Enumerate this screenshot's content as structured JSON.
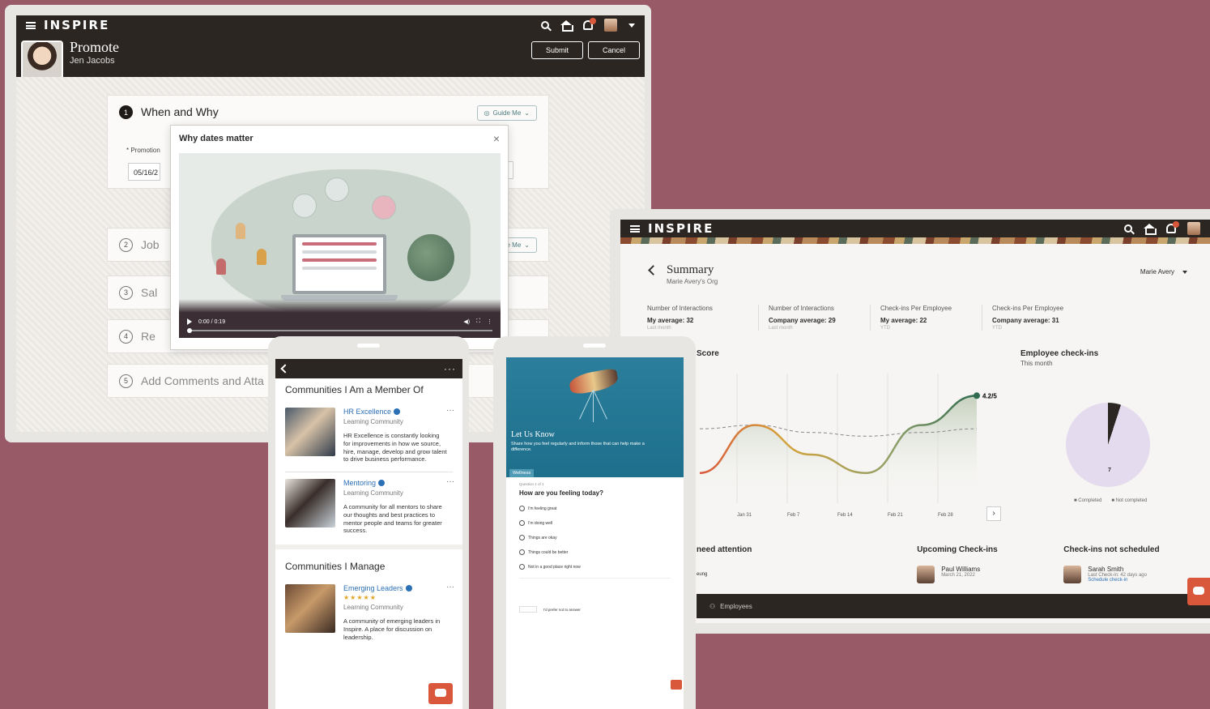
{
  "promote": {
    "brand": "INSPIRE",
    "title": "Promote",
    "subtitle": "Jen Jacobs",
    "submit_label": "Submit",
    "cancel_label": "Cancel",
    "guide_label": "Guide Me",
    "promotion_label": "* Promotion",
    "date_value": "05/16/2",
    "steps": [
      {
        "num": "1",
        "label": "When and Why"
      },
      {
        "num": "2",
        "label": "Job"
      },
      {
        "num": "3",
        "label": "Sal"
      },
      {
        "num": "4",
        "label": "Re"
      },
      {
        "num": "5",
        "label": "Add Comments and Atta"
      }
    ],
    "modal": {
      "title": "Why dates matter",
      "time": "0:00 / 0:19"
    }
  },
  "summary": {
    "brand": "INSPIRE",
    "title": "Summary",
    "subtitle": "Marie Avery's Org",
    "person_select": "Marie Avery",
    "metrics": [
      {
        "label": "Number of Interactions",
        "value": "My average: 32",
        "period": "Last month"
      },
      {
        "label": "Number of Interactions",
        "value": "Company average: 29",
        "period": "Last month"
      },
      {
        "label": "Check-ins Per Employee",
        "value": "My average: 22",
        "period": "YTD"
      },
      {
        "label": "Check-ins Per Employee",
        "value": "Company average: 31",
        "period": "YTD"
      }
    ],
    "score_title": "Score",
    "score_value": "4.2",
    "score_suffix": "/5",
    "chart_data": {
      "type": "line",
      "title": "Score",
      "x": [
        "Jan 31",
        "Feb 7",
        "Feb 14",
        "Feb 21",
        "Feb 28"
      ],
      "series": [
        {
          "values": [
            2.1,
            3.4,
            2.6,
            2.1,
            3.4,
            4.2
          ]
        },
        {
          "values": [
            3.3,
            3.4,
            3.2,
            3.1,
            3.2,
            3.3
          ]
        }
      ]
    },
    "checkins": {
      "title": "Employee check-ins",
      "subtitle": "This month",
      "completed_count": "1",
      "not_completed_count": "7",
      "legend_completed": "Completed",
      "legend_not_completed": "Not completed"
    },
    "need_attention_title": "need attention",
    "need_attention_name": "eung",
    "upcoming": {
      "title": "Upcoming Check-ins",
      "name": "Paul Williams",
      "date": "March 21, 2022"
    },
    "not_scheduled": {
      "title": "Check-ins not scheduled",
      "name": "Sarah Smith",
      "detail": "Last Check-in: 42 days ago",
      "link": "Schedule check-in"
    },
    "footer_label": "Employees"
  },
  "communities": {
    "member_title": "Communities I Am a Member Of",
    "manage_title": "Communities I Manage",
    "items": [
      {
        "name": "HR Excellence",
        "type": "Learning Community",
        "desc": "HR Excellence is constantly looking for improvements in how we source, hire, manage, develop and grow talent to drive business performance."
      },
      {
        "name": "Mentoring",
        "type": "Learning Community",
        "desc": "A community for all mentors to share our thoughts and best practices to mentor people and teams for greater success."
      },
      {
        "name": "Emerging Leaders",
        "type": "Learning Community",
        "stars": "★★★★★",
        "desc": "A community of emerging leaders in Inspire. A place for discussion on leadership."
      }
    ]
  },
  "survey": {
    "title": "Let Us Know",
    "subtitle": "Share how you feel regularly and inform those that can help make a difference.",
    "tag": "Wellness",
    "question_num": "Question 1 of 1",
    "question": "How are you feeling today?",
    "options": [
      "I'm feeling great",
      "I'm doing well",
      "Things are okay",
      "Things could be better",
      "Not in a good place right now"
    ],
    "skip_label": "I'd prefer not to answer"
  }
}
